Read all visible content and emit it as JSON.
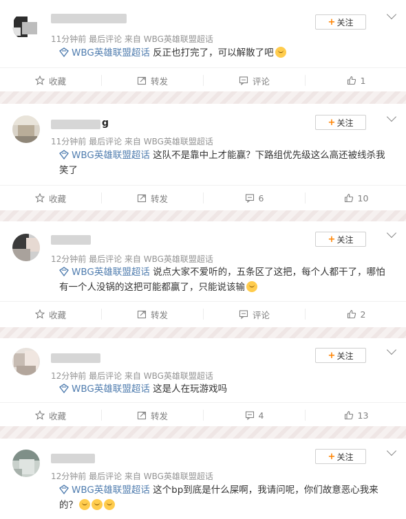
{
  "follow_label": "关注",
  "posts": [
    {
      "meta": "11分钟前  最后评论  来自 WBG英雄联盟超话",
      "name_tail": "",
      "topic": "WBG英雄联盟超话",
      "text": " 反正也打完了，可以解散了吧",
      "text2": "",
      "emoji": "hug-emoji",
      "actions": {
        "fav": "收藏",
        "share": "转发",
        "comment": "评论",
        "like": "1"
      }
    },
    {
      "meta": "11分钟前  最后评论  来自 WBG英雄联盟超话",
      "name_tail": "g",
      "topic": "WBG英雄联盟超话",
      "text": " 这队不是靠中上才能赢？下路组优先级这么高还被线杀我",
      "text2": "笑了",
      "emoji": "",
      "actions": {
        "fav": "收藏",
        "share": "转发",
        "comment": "6",
        "like": "10"
      }
    },
    {
      "meta": "12分钟前  最后评论  来自 WBG英雄联盟超话",
      "name_tail": "",
      "topic": "WBG英雄联盟超话",
      "text": " 说点大家不爱听的，五条区了这把，每个人都干了，哪怕",
      "text2": "有一个人没锅的这把可能都赢了，只能说该输",
      "emoji": "thinking-emoji",
      "actions": {
        "fav": "收藏",
        "share": "转发",
        "comment": "评论",
        "like": "2"
      }
    },
    {
      "meta": "12分钟前  最后评论  来自 WBG英雄联盟超话",
      "name_tail": "",
      "topic": "WBG英雄联盟超话",
      "text": " 这是人在玩游戏吗",
      "text2": "",
      "emoji": "",
      "actions": {
        "fav": "收藏",
        "share": "转发",
        "comment": "4",
        "like": "13"
      }
    },
    {
      "meta": "12分钟前  最后评论  来自 WBG英雄联盟超话",
      "name_tail": "",
      "topic": "WBG英雄联盟超话",
      "text": " 这个bp到底是什么屎啊，我请问呢，你们故意恶心我来",
      "text2": "的？",
      "emoji": "question-emoji",
      "actions": {
        "fav": "收藏",
        "share": "转发",
        "comment": "",
        "like": ""
      }
    }
  ]
}
